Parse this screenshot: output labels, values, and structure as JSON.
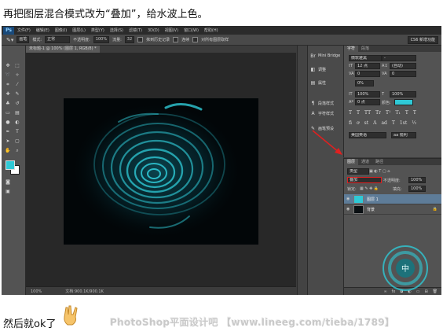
{
  "caption": {
    "text": "再把图层混合模式改为“叠加”，给水波上色。"
  },
  "menubar": {
    "logo": "Ps",
    "items": [
      "文件(F)",
      "编辑(E)",
      "图像(I)",
      "图层(L)",
      "类型(Y)",
      "选择(S)",
      "滤镜(T)",
      "3D(D)",
      "视图(V)",
      "窗口(W)",
      "帮助(H)"
    ]
  },
  "options": {
    "preset": "画笔",
    "mode_label": "模式:",
    "mode_value": "正常",
    "opacity_label": "不透明度:",
    "opacity_value": "100%",
    "flow_label": "流量:",
    "flow_value": "32",
    "erase_label": "抹到历史记录",
    "smooth_label": "连续",
    "sample_label": "对所有图层取样",
    "workspace": "CS6 新增功能"
  },
  "document": {
    "tab_title": "未标题-1 @ 100% (图层 1, RGB/8) *",
    "status_zoom": "100%",
    "status_doc": "文档:900.1K/900.1K"
  },
  "collapsed_panels": [
    {
      "icon": "mini-bridge-icon",
      "label": "Mini Bridge"
    },
    {
      "icon": "adjust-icon",
      "label": "调整"
    },
    {
      "icon": "properties-icon",
      "label": "属性"
    },
    {
      "icon": "paragraph-style-icon",
      "label": "段落样式"
    },
    {
      "icon": "char-style-icon",
      "label": "字符样式"
    },
    {
      "icon": "history-icon",
      "label": "画笔预设"
    }
  ],
  "character_panel": {
    "tabs": [
      "字符",
      "段落"
    ],
    "font_family": "微软雅黑",
    "font_style": "-",
    "font_size": "12 点",
    "leading": "(自动)",
    "kerning": "0",
    "tracking": "0",
    "percent": "0%",
    "vscale": "100%",
    "hscale": "100%",
    "baseline": "0 点",
    "color_label": "颜色:",
    "color_hex": "#2fc9d6",
    "glyphs": [
      "T",
      "T",
      "TT",
      "Tr",
      "T¹",
      "T₁",
      "T",
      "T"
    ],
    "language": "美国英语",
    "antialias": "aa 锐利"
  },
  "layers_panel": {
    "tabs": [
      "图层",
      "通道",
      "路径"
    ],
    "filter_label": "类型",
    "blend_mode": "叠加",
    "opacity_label": "不透明度:",
    "opacity_value": "100%",
    "lock_label": "锁定:",
    "fill_label": "填充:",
    "fill_value": "100%",
    "layers": [
      {
        "name": "图层 1",
        "selected": true,
        "thumb_color": "#2fc9d6"
      },
      {
        "name": "背景",
        "selected": false,
        "thumb_color": "#0a0f12",
        "locked": true
      }
    ],
    "bottom_icons": [
      "link-icon",
      "fx-icon",
      "mask-icon",
      "adjust-layer-icon",
      "group-icon",
      "new-layer-icon",
      "trash-icon"
    ]
  },
  "annotation": {
    "arrow_color": "#e02020"
  },
  "footer": {
    "text": "然后就ok了",
    "site": "PhotoShop平面设计吧 【www.lineeg.com/tieba/1789】"
  },
  "logo_stamp": {
    "char": "中"
  }
}
